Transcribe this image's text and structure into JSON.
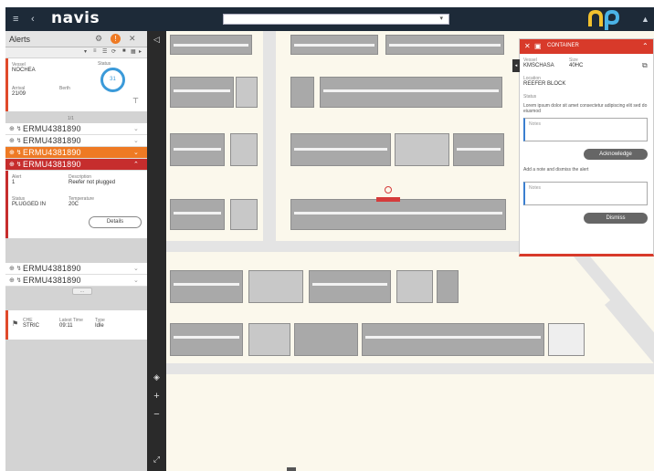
{
  "topbar": {
    "menu_icon": "hamburger-menu-icon",
    "back_icon": "back-arrow-icon",
    "logo": "navis",
    "search_placeholder": "",
    "dropdown_icon": "chevron-down-icon",
    "brand_logo": "np",
    "user_icon": "user-icon"
  },
  "alerts": {
    "title": "Alerts",
    "warning_count": "!",
    "vessel": {
      "name_label": "Vessel",
      "name_value": "NOCHEA",
      "status_label": "Status",
      "status_value": "",
      "arrival_label": "Arrival",
      "arrival_value": "21/09",
      "berth_label": "Berth",
      "berth_value": "",
      "gauge_value": "31"
    },
    "section_label": "1/1",
    "containers": [
      {
        "id": "ERMU4381890",
        "style": "normal"
      },
      {
        "id": "ERMU4381890",
        "style": "normal"
      },
      {
        "id": "ERMU4381890",
        "style": "orange"
      },
      {
        "id": "ERMU4381890",
        "style": "red"
      }
    ],
    "detail": {
      "f1_label": "Alert",
      "f1_value": "1",
      "f2_label": "Description",
      "f2_value": "Reefer not plugged",
      "f3_label": "Status",
      "f3_value": "PLUGGED IN",
      "f4_label": "Temperature",
      "f4_value": "20C",
      "details_button": "Details"
    },
    "containers_after": [
      {
        "id": "ERMU4381890",
        "style": "normal"
      },
      {
        "id": "ERMU4381890",
        "style": "normal"
      }
    ],
    "more_label": "...",
    "event": {
      "a_label": "CHE",
      "a_value": "STRIC",
      "b_label": "Latest Time",
      "b_value": "09:11",
      "c_label": "Type",
      "c_value": "Idle"
    }
  },
  "right_panel": {
    "title": "CONTAINER",
    "vessel_label": "Vessel",
    "vessel_value": "KMSCHASA",
    "size_label": "Size",
    "size_value": "40HC",
    "location_label": "Location",
    "location_value": "REEFER BLOCK",
    "status_label": "Status",
    "description": "Lorem ipsum dolor sit amet consectetur adipiscing elit sed do eiusmod",
    "note_placeholder": "Notes",
    "acknowledge_button": "Acknowledge",
    "description2": "Add a note and dismiss the alert",
    "note2_placeholder": "Notes",
    "dismiss_button": "Dismiss"
  },
  "map_tools": {
    "layers_icon": "layers-icon",
    "zoom_in": "+",
    "zoom_out": "−",
    "expand_icon": "expand-icon"
  },
  "colors": {
    "header": "#1d2a38",
    "alert_orange": "#ee7a24",
    "alert_red": "#c62d2d",
    "map_background": "#fbf8ec",
    "container_block": "#a9a9a9"
  }
}
